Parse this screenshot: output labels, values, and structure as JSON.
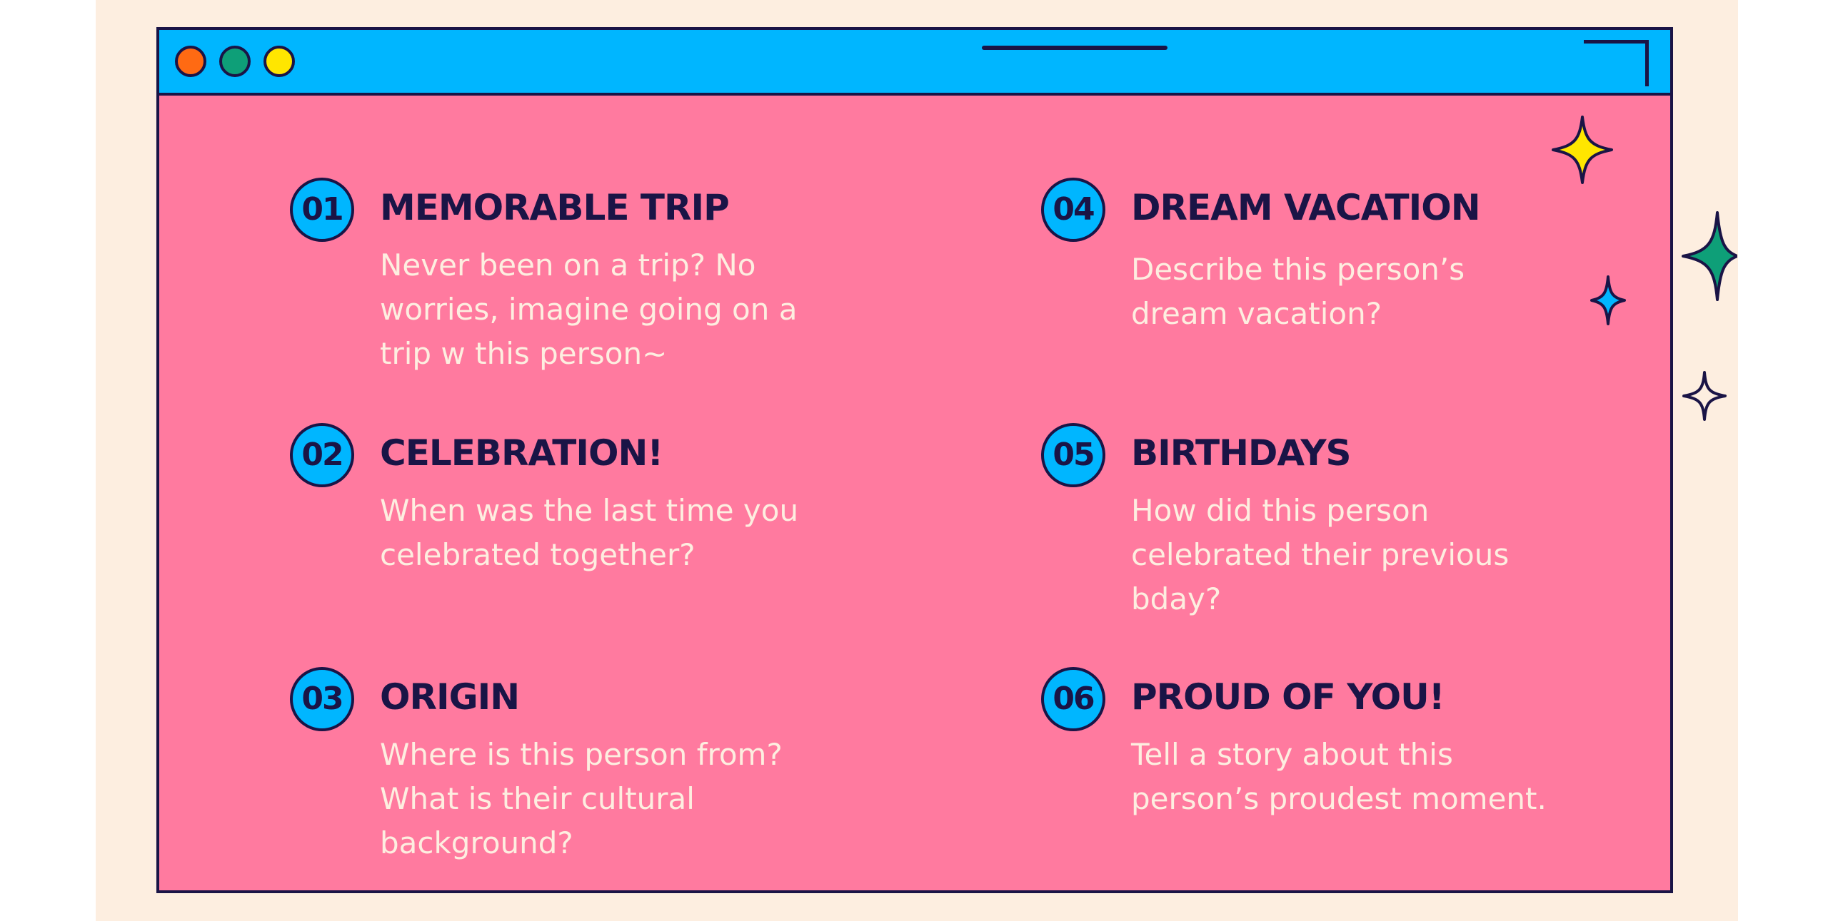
{
  "window": {
    "controls": [
      "close",
      "minimize",
      "maximize"
    ],
    "colors": {
      "background": "#fdeee0",
      "window_fill": "#ff7a9f",
      "titlebar": "#00b6ff",
      "outline": "#1a1446",
      "dot_close": "#ff6a13",
      "dot_minimize": "#0e9f78",
      "dot_maximize": "#ffe600"
    }
  },
  "items": [
    {
      "number": "01",
      "title": "MEMORABLE TRIP",
      "description": "Never been on a trip? No worries, imagine going on a trip w this person~"
    },
    {
      "number": "02",
      "title": "CELEBRATION!",
      "description": "When was the last time you celebrated together?"
    },
    {
      "number": "03",
      "title": "ORIGIN",
      "description": "Where is this person from? What is their cultural background?"
    },
    {
      "number": "04",
      "title": "DREAM VACATION",
      "description": "Describe this person’s dream vacation?"
    },
    {
      "number": "05",
      "title": "BIRTHDAYS",
      "description": "How did this person celebrated their previous bday?"
    },
    {
      "number": "06",
      "title": "PROUD OF YOU!",
      "description": "Tell a story about this person’s proudest moment."
    }
  ],
  "decorations": {
    "stars": [
      "yellow-sparkle-icon",
      "green-sparkle-icon",
      "blue-sparkle-icon",
      "outline-sparkle-icon"
    ],
    "star_colors": [
      "#ffe600",
      "#0e9f78",
      "#00b6ff",
      "#fdeee0"
    ]
  }
}
